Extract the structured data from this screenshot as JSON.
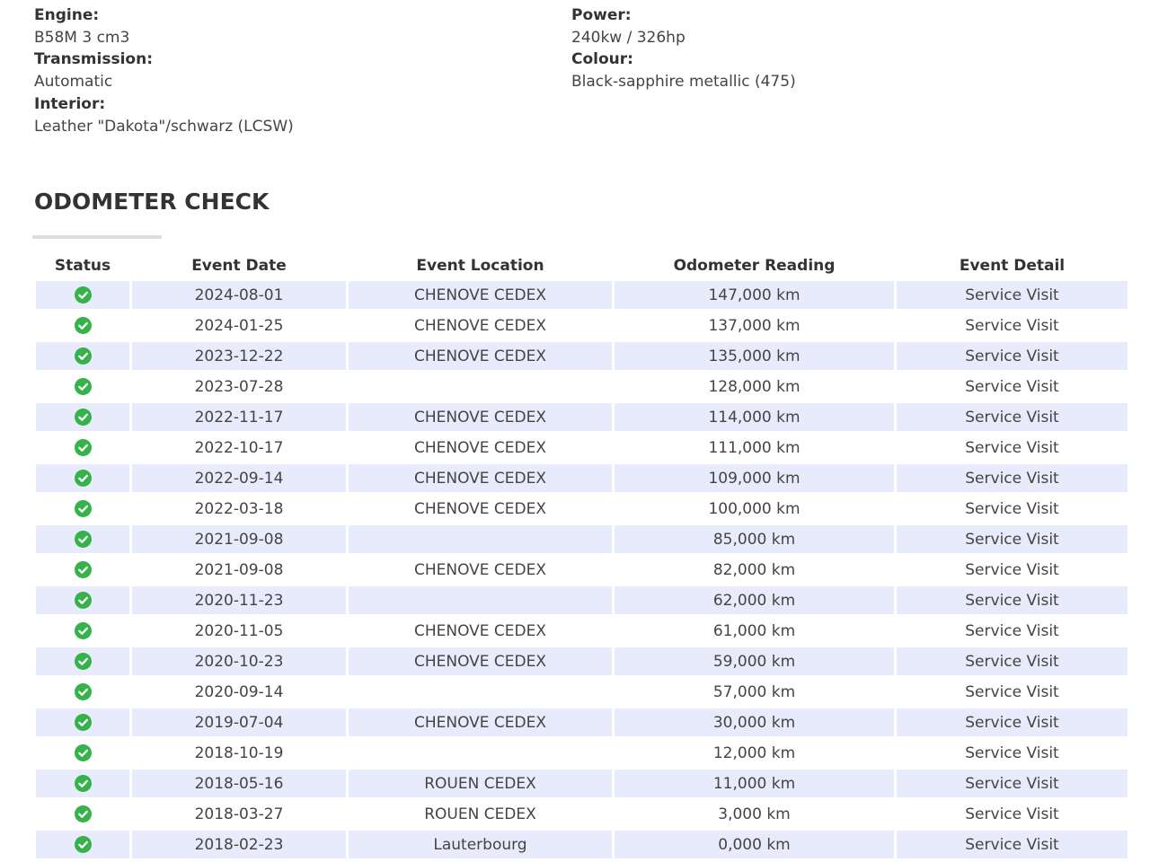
{
  "specs": {
    "left": [
      {
        "label": "Engine:",
        "value": "B58M 3 cm3"
      },
      {
        "label": "Transmission:",
        "value": "Automatic"
      },
      {
        "label": "Interior:",
        "value": "Leather \"Dakota\"/schwarz (LCSW)"
      }
    ],
    "right": [
      {
        "label": "Power:",
        "value": "240kw / 326hp"
      },
      {
        "label": "Colour:",
        "value": "Black-sapphire metallic (475)"
      }
    ]
  },
  "odometer_check": {
    "title": "ODOMETER CHECK",
    "columns": [
      "Status",
      "Event Date",
      "Event Location",
      "Odometer Reading",
      "Event Detail"
    ],
    "rows": [
      {
        "status_icon": "check-circle-icon",
        "date": "2024-08-01",
        "location": "CHENOVE CEDEX",
        "reading": "147,000 km",
        "detail": "Service Visit"
      },
      {
        "status_icon": "check-circle-icon",
        "date": "2024-01-25",
        "location": "CHENOVE CEDEX",
        "reading": "137,000 km",
        "detail": "Service Visit"
      },
      {
        "status_icon": "check-circle-icon",
        "date": "2023-12-22",
        "location": "CHENOVE CEDEX",
        "reading": "135,000 km",
        "detail": "Service Visit"
      },
      {
        "status_icon": "check-circle-icon",
        "date": "2023-07-28",
        "location": "",
        "reading": "128,000 km",
        "detail": "Service Visit"
      },
      {
        "status_icon": "check-circle-icon",
        "date": "2022-11-17",
        "location": "CHENOVE CEDEX",
        "reading": "114,000 km",
        "detail": "Service Visit"
      },
      {
        "status_icon": "check-circle-icon",
        "date": "2022-10-17",
        "location": "CHENOVE CEDEX",
        "reading": "111,000 km",
        "detail": "Service Visit"
      },
      {
        "status_icon": "check-circle-icon",
        "date": "2022-09-14",
        "location": "CHENOVE CEDEX",
        "reading": "109,000 km",
        "detail": "Service Visit"
      },
      {
        "status_icon": "check-circle-icon",
        "date": "2022-03-18",
        "location": "CHENOVE CEDEX",
        "reading": "100,000 km",
        "detail": "Service Visit"
      },
      {
        "status_icon": "check-circle-icon",
        "date": "2021-09-08",
        "location": "",
        "reading": "85,000 km",
        "detail": "Service Visit"
      },
      {
        "status_icon": "check-circle-icon",
        "date": "2021-09-08",
        "location": "CHENOVE CEDEX",
        "reading": "82,000 km",
        "detail": "Service Visit"
      },
      {
        "status_icon": "check-circle-icon",
        "date": "2020-11-23",
        "location": "",
        "reading": "62,000 km",
        "detail": "Service Visit"
      },
      {
        "status_icon": "check-circle-icon",
        "date": "2020-11-05",
        "location": "CHENOVE CEDEX",
        "reading": "61,000 km",
        "detail": "Service Visit"
      },
      {
        "status_icon": "check-circle-icon",
        "date": "2020-10-23",
        "location": "CHENOVE CEDEX",
        "reading": "59,000 km",
        "detail": "Service Visit"
      },
      {
        "status_icon": "check-circle-icon",
        "date": "2020-09-14",
        "location": "",
        "reading": "57,000 km",
        "detail": "Service Visit"
      },
      {
        "status_icon": "check-circle-icon",
        "date": "2019-07-04",
        "location": "CHENOVE CEDEX",
        "reading": "30,000 km",
        "detail": "Service Visit"
      },
      {
        "status_icon": "check-circle-icon",
        "date": "2018-10-19",
        "location": "",
        "reading": "12,000 km",
        "detail": "Service Visit"
      },
      {
        "status_icon": "check-circle-icon",
        "date": "2018-05-16",
        "location": "ROUEN CEDEX",
        "reading": "11,000 km",
        "detail": "Service Visit"
      },
      {
        "status_icon": "check-circle-icon",
        "date": "2018-03-27",
        "location": "ROUEN CEDEX",
        "reading": "3,000 km",
        "detail": "Service Visit"
      },
      {
        "status_icon": "check-circle-icon",
        "date": "2018-02-23",
        "location": "Lauterbourg",
        "reading": "0,000 km",
        "detail": "Service Visit"
      }
    ]
  },
  "icons": {
    "status_ok": "check-circle-icon"
  },
  "colors": {
    "status_ok": "#36b24a",
    "row_shade": "#e8ebfb",
    "text": "#444444",
    "heading": "#333333",
    "title_bar": "#dddddd"
  }
}
